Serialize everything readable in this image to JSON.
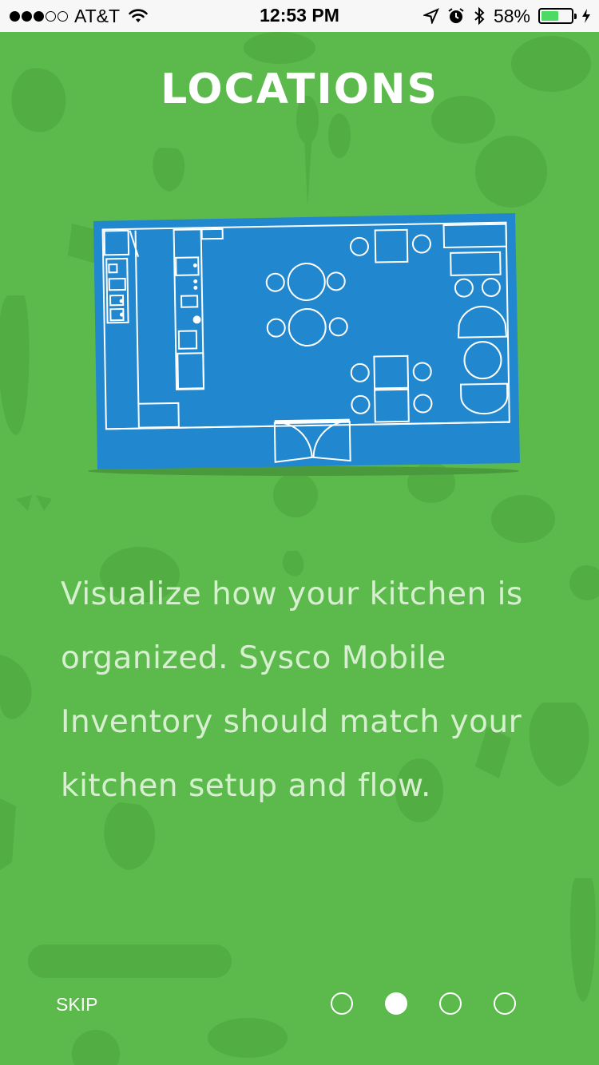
{
  "status_bar": {
    "carrier": "AT&T",
    "time": "12:53 PM",
    "battery_percent": "58%",
    "battery_level": 0.58,
    "signal_bars_filled": 3,
    "signal_bars_total": 5
  },
  "page": {
    "title": "LOCATIONS",
    "description": "Visualize how your kitchen is organized. Sysco Mobile Inventory should match your kitchen setup and flow."
  },
  "footer": {
    "skip_label": "SKIP",
    "pages_total": 4,
    "current_page": 2
  },
  "colors": {
    "background": "#5bba4b",
    "blueprint": "#2188d0",
    "text_muted": "#d6efcf"
  }
}
